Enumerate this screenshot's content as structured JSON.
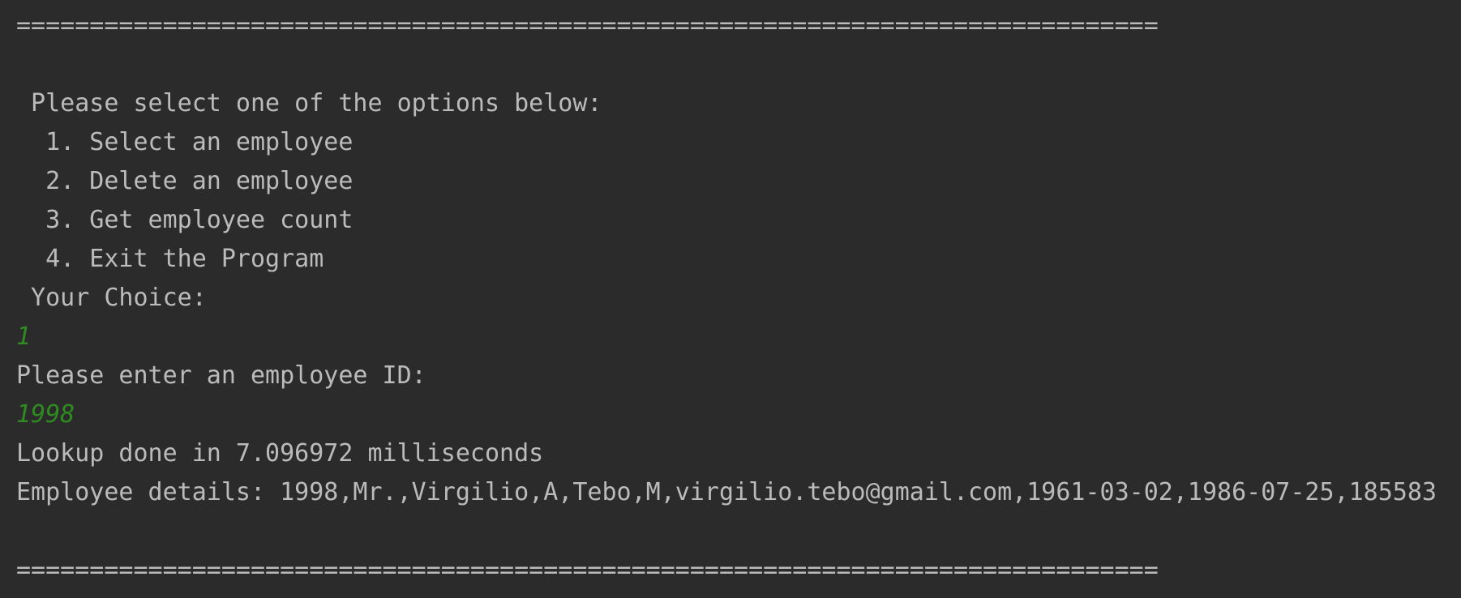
{
  "console": {
    "separator_top": "==============================================================================",
    "prompt_heading": " Please select one of the options below:",
    "options": [
      "  1. Select an employee",
      "  2. Delete an employee",
      "  3. Get employee count",
      "  4. Exit the Program"
    ],
    "choice_prompt": " Your Choice:",
    "choice_input": "1",
    "id_prompt": "Please enter an employee ID:",
    "id_input": "1998",
    "lookup_result": "Lookup done in 7.096972 milliseconds",
    "employee_details": "Employee details: 1998,Mr.,Virgilio,A,Tebo,M,virgilio.tebo@gmail.com,1961-03-02,1986-07-25,185583",
    "separator_bottom": "==============================================================================",
    "colors": {
      "background": "#2b2b2b",
      "output_text": "#bbbbbb",
      "user_input": "#2f8a21"
    }
  }
}
